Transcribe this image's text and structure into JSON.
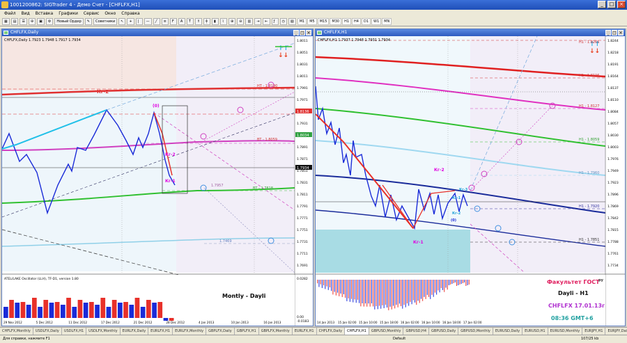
{
  "window": {
    "title": "1001200862: SIGTrader 4 - Демо Счет - [CHFLFX,H1]"
  },
  "menu": [
    "Файл",
    "Вид",
    "Вставка",
    "Графики",
    "Сервис",
    "Окно",
    "Справка"
  ],
  "toolbar": {
    "new_order": "Новый Ордер",
    "advisors": "Советники",
    "timeframes": [
      "M1",
      "M5",
      "M15",
      "M30",
      "H1",
      "H4",
      "D1",
      "W1",
      "MN"
    ]
  },
  "left_chart": {
    "title": "CHFLFX,Daily",
    "info": "CHFLFX,Daily 1.7923 1.7948 1.7917 1.7934",
    "prices": [
      "1.8011",
      "1.8051",
      "1.8031",
      "1.8011",
      "1.7991",
      "1.7971",
      "1.7951",
      "1.7931",
      "1.7911",
      "1.7891",
      "1.7871",
      "1.7851",
      "1.7831",
      "1.7811",
      "1.7791",
      "1.7771",
      "1.7751",
      "1.7731",
      "1.7711",
      "1.7691"
    ],
    "labels": {
      "kr2": "Кг-2",
      "kr1": "Кг-1",
      "krA": "Кг-2",
      "zero": "(0)",
      "lvl1": "НТ - 1.8190",
      "lvl2": "ВТ - 1.8059",
      "lvl3": "ВТ - 1.7818",
      "lvl4": "1.7957",
      "lvl5": "1.7469"
    },
    "price_tags": {
      "a": "1.8136",
      "b": "1.8034",
      "c": "1.7934"
    },
    "osc_title": "ATEL/LAKE Oscillator (LLH), TF-D1, version 1.80",
    "osc_scale": [
      "0.0282",
      "0.00",
      "-0.0183"
    ],
    "overlay": "Montly - Dayli",
    "dates": [
      "29 Nov 2012",
      "5 Dec 2012",
      "11 Dec 2012",
      "17 Dec 2012",
      "21 Dec 2012",
      "28 Dec 2012",
      "4 Jan 2013",
      "10 Jan 2013",
      "16 Jan 2013"
    ]
  },
  "right_chart": {
    "title": "CHFLFX,H1",
    "info": "CHFLFX,H1 1.7937 1.7948 1.7931 1.7934",
    "prices": [
      "1.8244",
      "1.8218",
      "1.8191",
      "1.8164",
      "1.8137",
      "1.8110",
      "1.8084",
      "1.8057",
      "1.8030",
      "1.8003",
      "1.7976",
      "1.7949",
      "1.7923",
      "1.7896",
      "1.7869",
      "1.7842",
      "1.7815",
      "1.7788",
      "1.7761",
      "1.7734"
    ],
    "labels": {
      "kr2": "Кг-2",
      "kr1": "Кг-1",
      "krA": "Кг-1",
      "krB": "Кг-3",
      "krC": "Кг-2",
      "zero": "(0)",
      "h1a": "Н1 - 1.8265",
      "h1b": "Н1 - 1.8196",
      "h1c": "Н1 - 1.8127",
      "h1d": "Н1 - 1.8059",
      "h1e": "Н1 - 1.7960",
      "h1f": "Н1 - 1.7920",
      "h1g": "Н1 - 1.7851"
    },
    "dates": [
      "14 Jan 2013",
      "15 Jan 02:00",
      "15 Jan 10:00",
      "15 Jan 18:00",
      "16 Jan 02:00",
      "16 Jan 10:00",
      "16 Jan 18:00",
      "17 Jan 02:00"
    ],
    "info_box": {
      "line1": "Факультет ГОСТ",
      "line1b": "ру",
      "line2": "Dayli - H1",
      "line3": "CHFLFX 17.01.13г",
      "line4": "08:36 GMT+6"
    }
  },
  "tabs": [
    "CHFLFX,Monthly",
    "USDLFX,Daily",
    "USDLFX,H1",
    "USDLFX,Monthly",
    "EURLFX,Daily",
    "EURLFX,H1",
    "EURLFX,Monthly",
    "GBPLFX,Daily",
    "GBPLFX,H1",
    "GBPLFX,Monthly",
    "EURLFX,H1",
    "CHFLFX,Daily",
    "CHFLFX,H1",
    "GBPUSD,Monthly",
    "GBPUSD,H4",
    "GBPUSD,Daily",
    "GBPUSD,Monthly",
    "EURUSD,Daily",
    "EURUSD,H1",
    "EURUSD,Monthly",
    "EURJPY,H1",
    "EURJPY,Daily",
    "EUR"
  ],
  "active_tab": "CHFLFX,H1",
  "status": {
    "help": "Для справки, нажмите F1",
    "profile": "Default",
    "traffic": "107/25 kb"
  },
  "colors": {
    "bull": "#1a2bd8",
    "bear": "#e8312a",
    "kr_magenta": "#e000e0",
    "accent_cyan": "#20c0e8"
  }
}
